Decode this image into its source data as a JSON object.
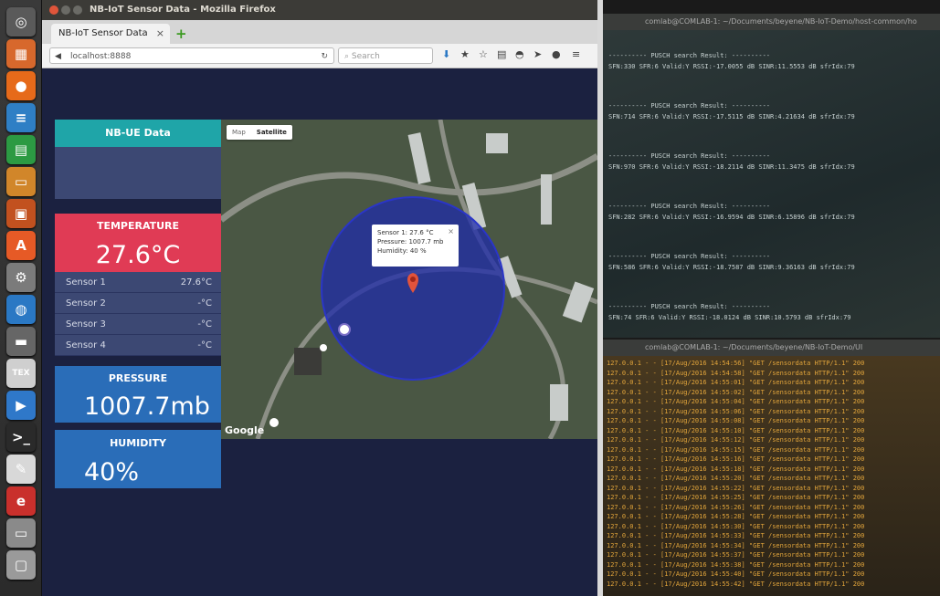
{
  "launcher": {
    "icons": [
      {
        "name": "dash-icon",
        "glyph": "◎",
        "color": "#5a5a5a"
      },
      {
        "name": "files-icon",
        "glyph": "▦",
        "color": "#d7682c"
      },
      {
        "name": "firefox-icon",
        "glyph": "●",
        "color": "#e66a1a"
      },
      {
        "name": "writer-icon",
        "glyph": "≡",
        "color": "#2f7fc5"
      },
      {
        "name": "calc-icon",
        "glyph": "▤",
        "color": "#2c9a43"
      },
      {
        "name": "impress-icon",
        "glyph": "▭",
        "color": "#d1862a"
      },
      {
        "name": "draw-icon",
        "glyph": "▣",
        "color": "#c2511f"
      },
      {
        "name": "software-center-icon",
        "glyph": "A",
        "color": "#e65a26"
      },
      {
        "name": "settings-icon",
        "glyph": "⚙",
        "color": "#7b7b7b"
      },
      {
        "name": "browser-globe-icon",
        "glyph": "◍",
        "color": "#2a78c4"
      },
      {
        "name": "drive-icon",
        "glyph": "▬",
        "color": "#666666"
      },
      {
        "name": "tex-icon",
        "glyph": "TEX",
        "color": "#cfcfcf"
      },
      {
        "name": "media-player-icon",
        "glyph": "▶",
        "color": "#2f78c9"
      },
      {
        "name": "terminal-icon",
        "glyph": ">_",
        "color": "#2a2a2a"
      },
      {
        "name": "text-editor-icon",
        "glyph": "✎",
        "color": "#d8d8d8"
      },
      {
        "name": "red-app-icon",
        "glyph": "e",
        "color": "#c9302c"
      },
      {
        "name": "disk-icon",
        "glyph": "▭",
        "color": "#8a8a8a"
      },
      {
        "name": "trash-icon",
        "glyph": "▢",
        "color": "#9a9a9a"
      }
    ]
  },
  "browser": {
    "window_title": "NB-IoT Sensor Data - Mozilla Firefox",
    "tab_label": "NB-IoT Sensor Data",
    "tab_close": "×",
    "new_tab": "+",
    "url": "localhost:8888",
    "search_placeholder": "Search"
  },
  "dashboard": {
    "nbue": {
      "title": "NB-UE Data",
      "color": "#1fa5a8"
    },
    "temperature": {
      "title": "TEMPERATURE",
      "value": "27.6°C",
      "color": "#e03b55",
      "sensors": [
        {
          "label": "Sensor 1",
          "value": "27.6°C"
        },
        {
          "label": "Sensor 2",
          "value": "-°C"
        },
        {
          "label": "Sensor 3",
          "value": "-°C"
        },
        {
          "label": "Sensor 4",
          "value": "-°C"
        }
      ]
    },
    "pressure": {
      "title": "PRESSURE",
      "value": "1007.7mb",
      "color": "#2a6db8"
    },
    "humidity": {
      "title": "HUMIDITY",
      "value": "40%",
      "color": "#2a6db8"
    }
  },
  "map": {
    "map_button": "Map",
    "satellite_button": "Satellite",
    "info_lines": [
      "Sensor 1: 27.6 °C",
      "Pressure: 1007.7 mb",
      "Humidity: 40 %"
    ],
    "info_close": "×",
    "google_logo": "Google",
    "circle_color": "#1f2ba8"
  },
  "terminal1": {
    "title": "comlab@COMLAB-1: ~/Documents/beyene/NB-IoT-Demo/host-common/ho",
    "blocks": [
      {
        "header": "---------- PUSCH search Result: ----------",
        "line": "SFN:330 SFR:6 Valid:Y RSSI:-17.0055 dB SINR:11.5553 dB sfrIdx:79"
      },
      {
        "header": "---------- PUSCH search Result: ----------",
        "line": "SFN:714 SFR:6 Valid:Y RSSI:-17.5115 dB SINR:4.21634 dB sfrIdx:79"
      },
      {
        "header": "---------- PUSCH search Result: ----------",
        "line": "SFN:970 SFR:6 Valid:Y RSSI:-18.2114 dB SINR:11.3475 dB sfrIdx:79"
      },
      {
        "header": "---------- PUSCH search Result: ----------",
        "line": "SFN:282 SFR:6 Valid:Y RSSI:-16.9594 dB SINR:6.15896 dB sfrIdx:79"
      },
      {
        "header": "---------- PUSCH search Result: ----------",
        "line": "SFN:586 SFR:6 Valid:Y RSSI:-18.7587 dB SINR:9.36163 dB sfrIdx:79"
      },
      {
        "header": "---------- PUSCH search Result: ----------",
        "line": "SFN:74 SFR:6 Valid:Y RSSI:-18.0124 dB SINR:10.5793 dB sfrIdx:79"
      }
    ]
  },
  "terminal2": {
    "title": "comlab@COMLAB-1: ~/Documents/beyene/NB-IoT-Demo/UI",
    "lines": [
      "127.0.0.1 - - [17/Aug/2016 14:54:56] \"GET /sensordata HTTP/1.1\" 200",
      "127.0.0.1 - - [17/Aug/2016 14:54:58] \"GET /sensordata HTTP/1.1\" 200",
      "127.0.0.1 - - [17/Aug/2016 14:55:01] \"GET /sensordata HTTP/1.1\" 200",
      "127.0.0.1 - - [17/Aug/2016 14:55:02] \"GET /sensordata HTTP/1.1\" 200",
      "127.0.0.1 - - [17/Aug/2016 14:55:04] \"GET /sensordata HTTP/1.1\" 200",
      "127.0.0.1 - - [17/Aug/2016 14:55:06] \"GET /sensordata HTTP/1.1\" 200",
      "127.0.0.1 - - [17/Aug/2016 14:55:08] \"GET /sensordata HTTP/1.1\" 200",
      "127.0.0.1 - - [17/Aug/2016 14:55:10] \"GET /sensordata HTTP/1.1\" 200",
      "127.0.0.1 - - [17/Aug/2016 14:55:12] \"GET /sensordata HTTP/1.1\" 200",
      "127.0.0.1 - - [17/Aug/2016 14:55:15] \"GET /sensordata HTTP/1.1\" 200",
      "127.0.0.1 - - [17/Aug/2016 14:55:16] \"GET /sensordata HTTP/1.1\" 200",
      "127.0.0.1 - - [17/Aug/2016 14:55:18] \"GET /sensordata HTTP/1.1\" 200",
      "127.0.0.1 - - [17/Aug/2016 14:55:20] \"GET /sensordata HTTP/1.1\" 200",
      "127.0.0.1 - - [17/Aug/2016 14:55:22] \"GET /sensordata HTTP/1.1\" 200",
      "127.0.0.1 - - [17/Aug/2016 14:55:25] \"GET /sensordata HTTP/1.1\" 200",
      "127.0.0.1 - - [17/Aug/2016 14:55:26] \"GET /sensordata HTTP/1.1\" 200",
      "127.0.0.1 - - [17/Aug/2016 14:55:28] \"GET /sensordata HTTP/1.1\" 200",
      "127.0.0.1 - - [17/Aug/2016 14:55:30] \"GET /sensordata HTTP/1.1\" 200",
      "127.0.0.1 - - [17/Aug/2016 14:55:33] \"GET /sensordata HTTP/1.1\" 200",
      "127.0.0.1 - - [17/Aug/2016 14:55:34] \"GET /sensordata HTTP/1.1\" 200",
      "127.0.0.1 - - [17/Aug/2016 14:55:37] \"GET /sensordata HTTP/1.1\" 200",
      "127.0.0.1 - - [17/Aug/2016 14:55:38] \"GET /sensordata HTTP/1.1\" 200",
      "127.0.0.1 - - [17/Aug/2016 14:55:40] \"GET /sensordata HTTP/1.1\" 200",
      "127.0.0.1 - - [17/Aug/2016 14:55:42] \"GET /sensordata HTTP/1.1\" 200"
    ]
  }
}
